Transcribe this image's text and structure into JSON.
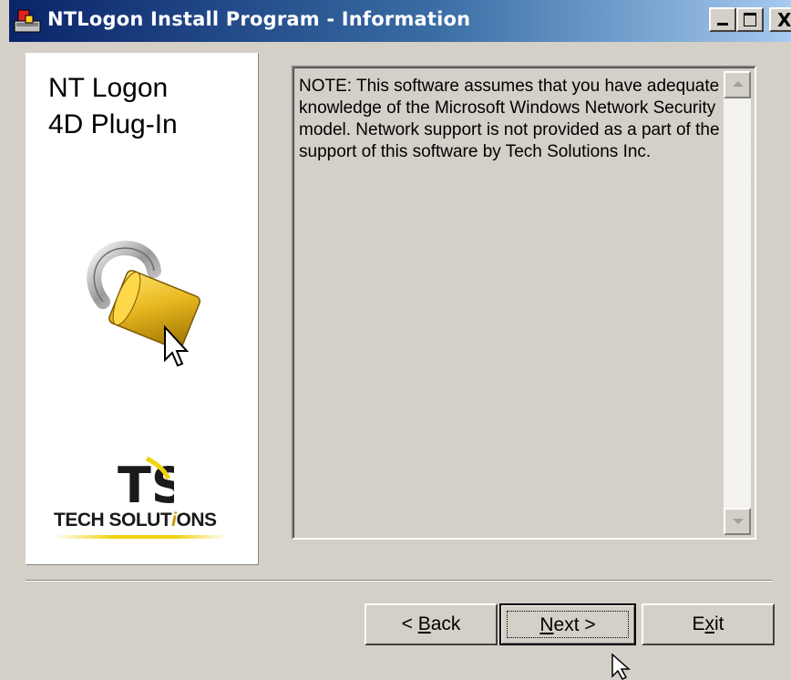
{
  "window": {
    "title": "NTLogon Install Program - Information",
    "icon": "installer-icon",
    "controls": {
      "minimize": "minimize-icon",
      "maximize": "maximize-icon",
      "close_label": "X"
    }
  },
  "sidebar": {
    "product_title": "NT Logon\n4D Plug-In",
    "illustration": "padlock-with-cursor",
    "logo": {
      "mark": "TS",
      "text_before_i": "TECH SOLUT",
      "text_i": "i",
      "text_after_i": "ONS"
    }
  },
  "info": {
    "text": "NOTE:  This software assumes that you have adequate knowledge of the Microsoft Windows Network Security model.  Network support is not provided as a part of the support of this software by Tech Solutions Inc."
  },
  "buttons": {
    "back": {
      "prefix": "< ",
      "mnemonic": "B",
      "rest": "ack"
    },
    "next": {
      "mnemonic": "N",
      "rest": "ext >"
    },
    "exit": {
      "prefix": "E",
      "mnemonic": "x",
      "rest": "it"
    }
  },
  "colors": {
    "titlebar_start": "#0a246a",
    "titlebar_end": "#a6caf0",
    "dialog_bg": "#d4d0c8",
    "lock_gold": "#e8b820",
    "logo_yellow": "#f2d20d"
  }
}
